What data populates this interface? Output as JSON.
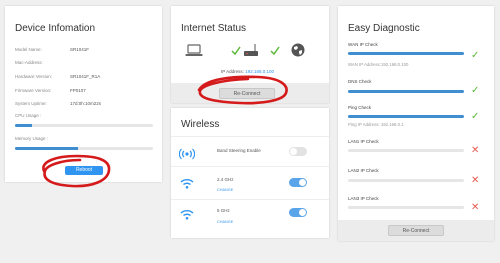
{
  "device": {
    "title": "Device Infomation",
    "rows": [
      {
        "label": "Model Name:",
        "value": "SR1041F"
      },
      {
        "label": "Mac-Address:",
        "value": ""
      },
      {
        "label": "Hardware Version:",
        "value": "SR1041F_R1A"
      },
      {
        "label": "Firmware Version:",
        "value": "FP0107"
      },
      {
        "label": "System Uptime:",
        "value": "17d:0h:10m22s"
      }
    ],
    "cpu_label": "CPU Usage :",
    "cpu_usage": 0.12,
    "memory_label": "Memory Usage :",
    "memory_usage": 0.46,
    "reboot_label": "Reboot"
  },
  "internet": {
    "title": "Internet Status",
    "icons": [
      "laptop-icon",
      "check-icon",
      "router-icon",
      "check-icon",
      "globe-icon"
    ],
    "ip_label": "IP Address: ",
    "ip_value": "192.168.0.100",
    "reconnect_label": "Re-Connect"
  },
  "wireless": {
    "title": "Wireless",
    "band_steering_label": "Band Steering Enable",
    "band_steering_enabled": false,
    "bands": [
      {
        "label": "2.4 GHz",
        "change": "CHANGE",
        "enabled": true
      },
      {
        "label": "5 GHz",
        "change": "CHANGE",
        "enabled": true
      }
    ]
  },
  "diagnostic": {
    "title": "Easy Diagnostic",
    "checks": [
      {
        "label": "WAN IP Check",
        "status": "pass",
        "sub": "WAN IP Address:192.168.0.100"
      },
      {
        "label": "DNS Check",
        "status": "pass",
        "sub": ""
      },
      {
        "label": "Ping Check",
        "status": "pass",
        "sub": "Ping IP Address: 192.168.0.1"
      },
      {
        "label": "LAN1 IP Check",
        "status": "fail",
        "sub": ""
      },
      {
        "label": "LAN2 IP Check",
        "status": "fail",
        "sub": ""
      },
      {
        "label": "LAN3 IP Check",
        "status": "fail",
        "sub": ""
      }
    ],
    "reconnect_label": "Re-Connect"
  },
  "colors": {
    "accent": "#2f95f1",
    "progress": "#3e8ed0",
    "pass": "#5cb83a",
    "fail": "#e45a4f",
    "annotation": "#d41a1a"
  }
}
